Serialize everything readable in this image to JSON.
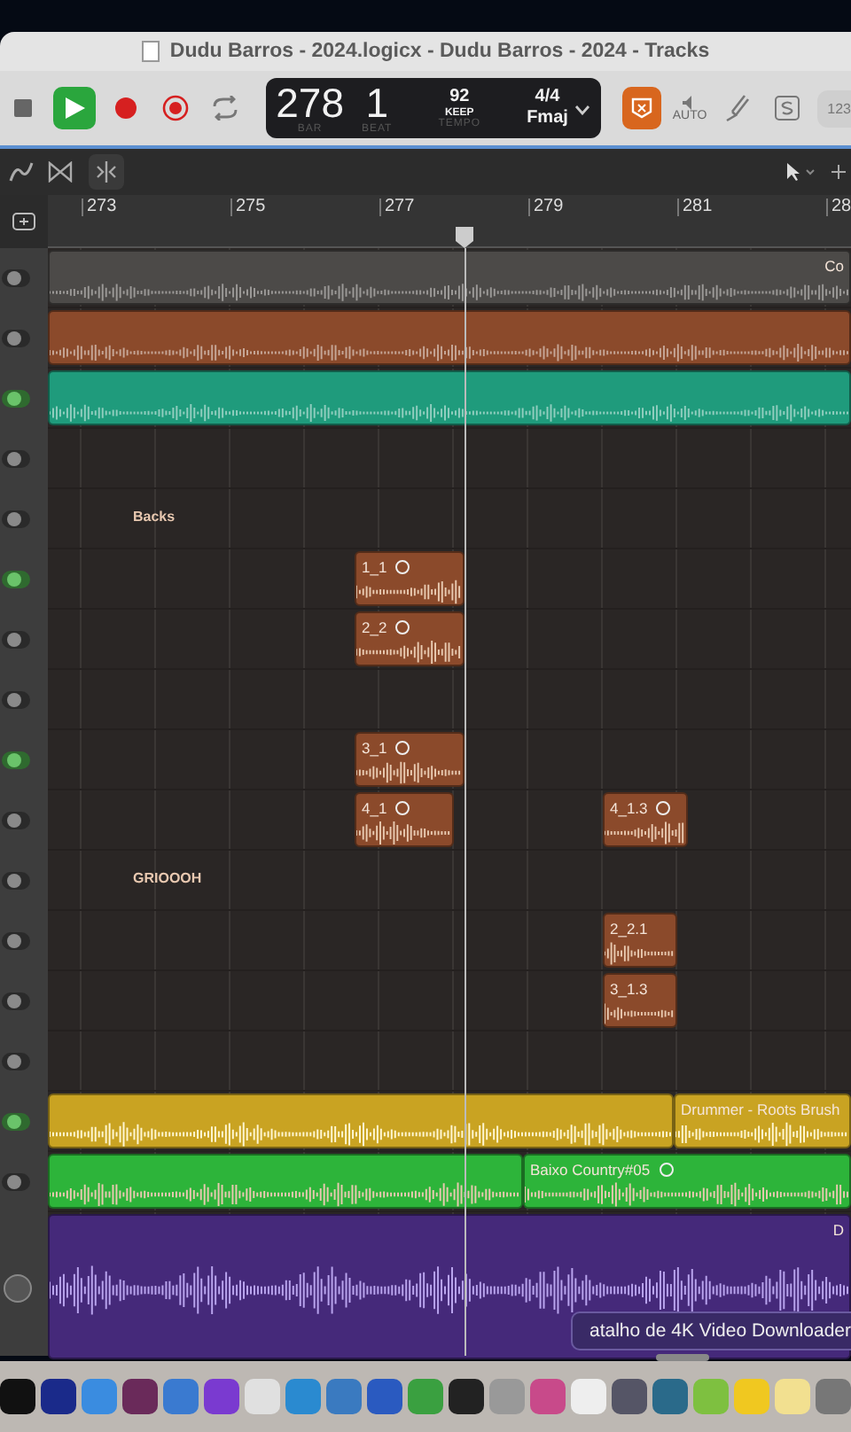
{
  "window": {
    "title": "Dudu Barros - 2024.logicx - Dudu Barros - 2024 - Tracks"
  },
  "transport": [
    {
      "kind": "stop",
      "on": false
    },
    {
      "kind": "play",
      "on": true
    },
    {
      "kind": "record",
      "on": false
    },
    {
      "kind": "capture",
      "on": false
    },
    {
      "kind": "cycle",
      "on": false
    }
  ],
  "lcd": {
    "bar": "278",
    "bar_label": "BAR",
    "beat": "1",
    "beat_label": "BEAT",
    "tempo": "92",
    "tempo_mode": "KEEP",
    "tempo_label": "TEMPO",
    "signature": "4/4",
    "key": "Fmaj"
  },
  "toolbar_right": {
    "auto_label": "AUTO",
    "counter": "123",
    "smart_on": true
  },
  "ruler": {
    "marks": [
      "273",
      "275",
      "277",
      "279",
      "281",
      "28"
    ]
  },
  "tracks": [
    {
      "kind": "audio",
      "on": false,
      "color": "#4c4a48",
      "regions": [
        {
          "name": "Co",
          "looped": false
        }
      ]
    },
    {
      "kind": "audio",
      "on": false,
      "color": "#8b4a2b",
      "regions": [
        {
          "looped": false
        }
      ]
    },
    {
      "kind": "audio",
      "on": true,
      "color": "#1f9b7c",
      "regions": [
        {
          "looped": false
        }
      ]
    },
    {
      "kind": "audio",
      "on": false
    },
    {
      "kind": "folder",
      "on": false,
      "label": "Backs"
    },
    {
      "kind": "audio",
      "on": true,
      "color": "#8b4a2b",
      "regions": [
        {
          "name": "1_1",
          "looped": true
        }
      ]
    },
    {
      "kind": "audio",
      "on": false,
      "color": "#8b4a2b",
      "regions": [
        {
          "name": "2_2",
          "looped": true
        }
      ]
    },
    {
      "kind": "audio",
      "on": false
    },
    {
      "kind": "audio",
      "on": true,
      "color": "#8b4a2b",
      "regions": [
        {
          "name": "3_1",
          "looped": true
        }
      ]
    },
    {
      "kind": "audio",
      "on": false,
      "color": "#8b4a2b",
      "regions": [
        {
          "name": "4_1",
          "looped": true
        },
        {
          "name": "4_1.3",
          "looped": true
        }
      ]
    },
    {
      "kind": "folder",
      "on": false,
      "label": "GRIOOOH"
    },
    {
      "kind": "audio",
      "on": false,
      "color": "#8b4a2b",
      "regions": [
        {
          "name": "2_2.1",
          "looped": false
        }
      ]
    },
    {
      "kind": "audio",
      "on": false,
      "color": "#8b4a2b",
      "regions": [
        {
          "name": "3_1.3",
          "looped": false
        }
      ]
    },
    {
      "kind": "audio",
      "on": false
    },
    {
      "kind": "drummer",
      "on": true,
      "color": "#c9a322",
      "regions": [
        {
          "looped": false
        },
        {
          "name": "Drummer - Roots Brush"
        }
      ]
    },
    {
      "kind": "audio",
      "on": false,
      "color": "#2db43a",
      "regions": [
        {
          "looped": false
        },
        {
          "name": "Baixo Country#05",
          "looped": true
        }
      ]
    },
    {
      "kind": "tall",
      "color": "#45297a",
      "regions": [
        {
          "name": "D",
          "looped": false
        }
      ]
    }
  ],
  "tooltip": "atalho de 4K Video Downloader"
}
